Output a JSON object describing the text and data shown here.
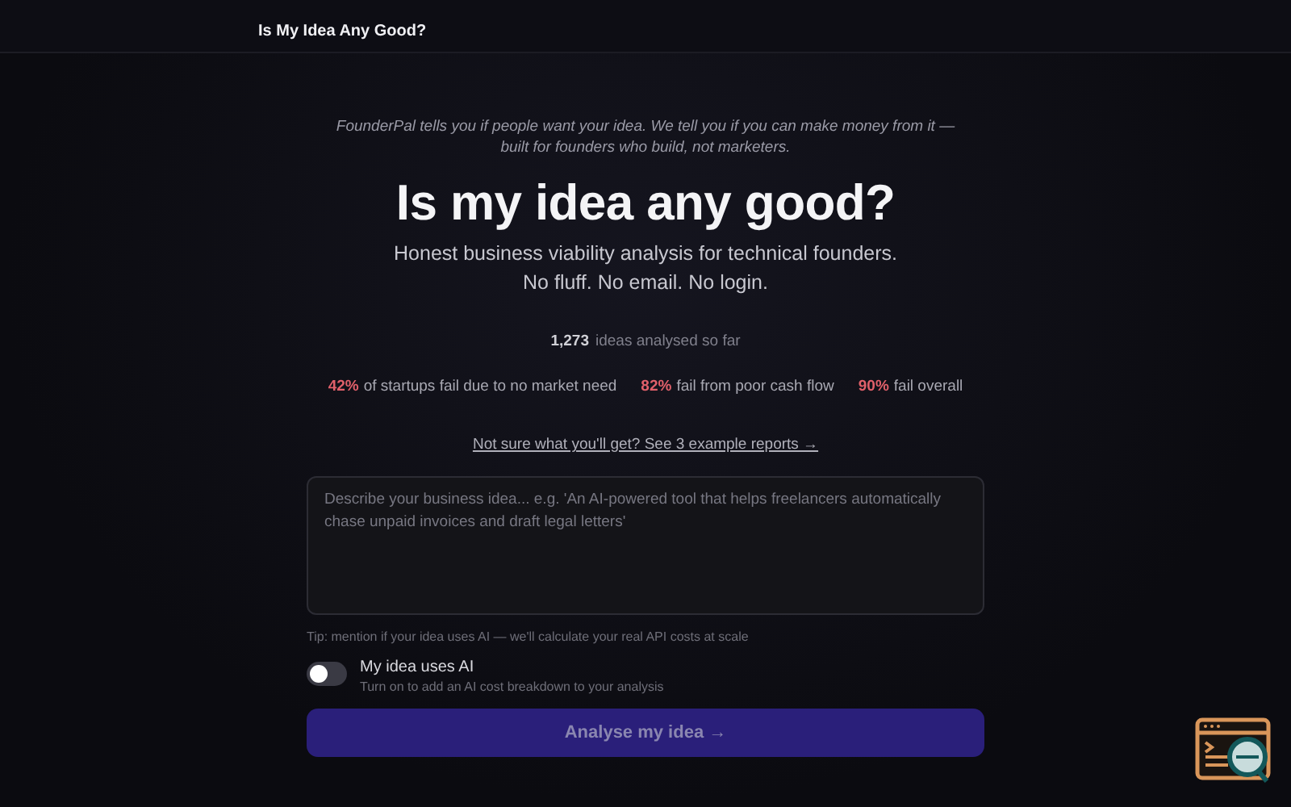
{
  "header": {
    "title": "Is My Idea Any Good?"
  },
  "tagline": "FounderPal tells you if people want your idea. We tell you if you can make money from it — built for founders who build, not marketers.",
  "headline": "Is my idea any good?",
  "subheadline": [
    "Honest business viability analysis for technical founders.",
    "No fluff. No email. No login."
  ],
  "counter": {
    "count": "1,273",
    "text": "ideas analysed so far"
  },
  "stats": [
    {
      "figure": "42%",
      "text": "of startups fail due to no market need"
    },
    {
      "figure": "82%",
      "text": "fail from poor cash flow"
    },
    {
      "figure": "90%",
      "text": "fail overall"
    }
  ],
  "examples_link": "Not sure what you'll get? See 3 example reports →",
  "idea_field": {
    "placeholder": "Describe your business idea... e.g. 'An AI-powered tool that helps freelancers automatically chase unpaid invoices and draft legal letters'"
  },
  "tip": "Tip: mention if your idea uses AI — we'll calculate your real API costs at scale",
  "ai_toggle": {
    "label": "My idea uses AI",
    "hint": "Turn on to add an AI cost breakdown to your analysis",
    "on": false
  },
  "submit": {
    "label": "Analyse my idea →",
    "disabled": true
  }
}
